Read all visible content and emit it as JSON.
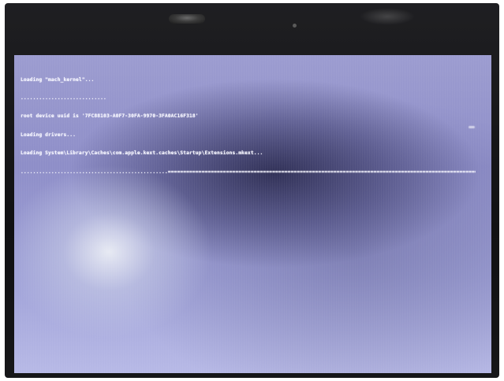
{
  "console": {
    "lines": [
      "Loading \"mach_kernel\"...",
      "............................",
      "root device uuid is '7FC88103-A0F7-30FA-9970-3FA0AC16F318'",
      "Loading drivers...",
      "Loading System\\Library\\Caches\\com.apple.kext.caches\\Startup\\Extensions.mkext...",
      "................................................========================================================================================================================================"
    ]
  },
  "colors": {
    "screen": "#9c9cd0",
    "text": "#f4f4ff",
    "bezel": "#161618"
  },
  "icons": [
    "webcam"
  ]
}
